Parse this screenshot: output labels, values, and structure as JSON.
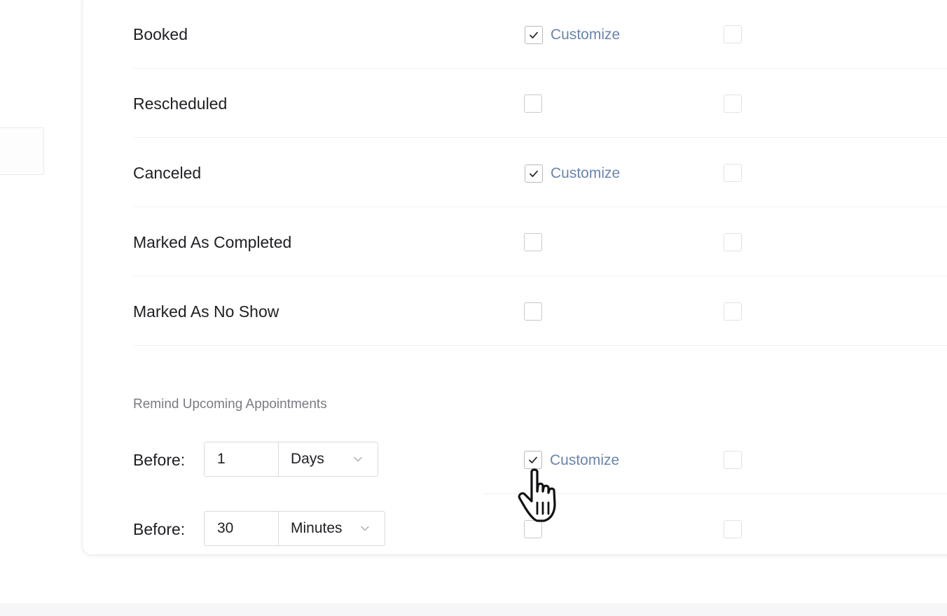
{
  "events": [
    {
      "label": "Booked",
      "checked": true,
      "customize_label": "Customize"
    },
    {
      "label": "Rescheduled",
      "checked": false,
      "customize_label": ""
    },
    {
      "label": "Canceled",
      "checked": true,
      "customize_label": "Customize"
    },
    {
      "label": "Marked As Completed",
      "checked": false,
      "customize_label": ""
    },
    {
      "label": "Marked As No Show",
      "checked": false,
      "customize_label": ""
    }
  ],
  "reminders": {
    "section_title": "Remind Upcoming Appointments",
    "rows": [
      {
        "label": "Before:",
        "value": "1",
        "unit": "Days",
        "checked": true,
        "customize_label": "Customize"
      },
      {
        "label": "Before:",
        "value": "30",
        "unit": "Minutes",
        "checked": false,
        "customize_label": ""
      }
    ]
  },
  "icons": {
    "check": "check-icon",
    "chevron": "chevron-down-icon",
    "cursor": "hand-pointer-cursor-icon"
  },
  "colors": {
    "link": "#6a84ad",
    "border": "#c9c9cf",
    "text": "#1f1f24",
    "muted_text": "#7a7a82"
  }
}
